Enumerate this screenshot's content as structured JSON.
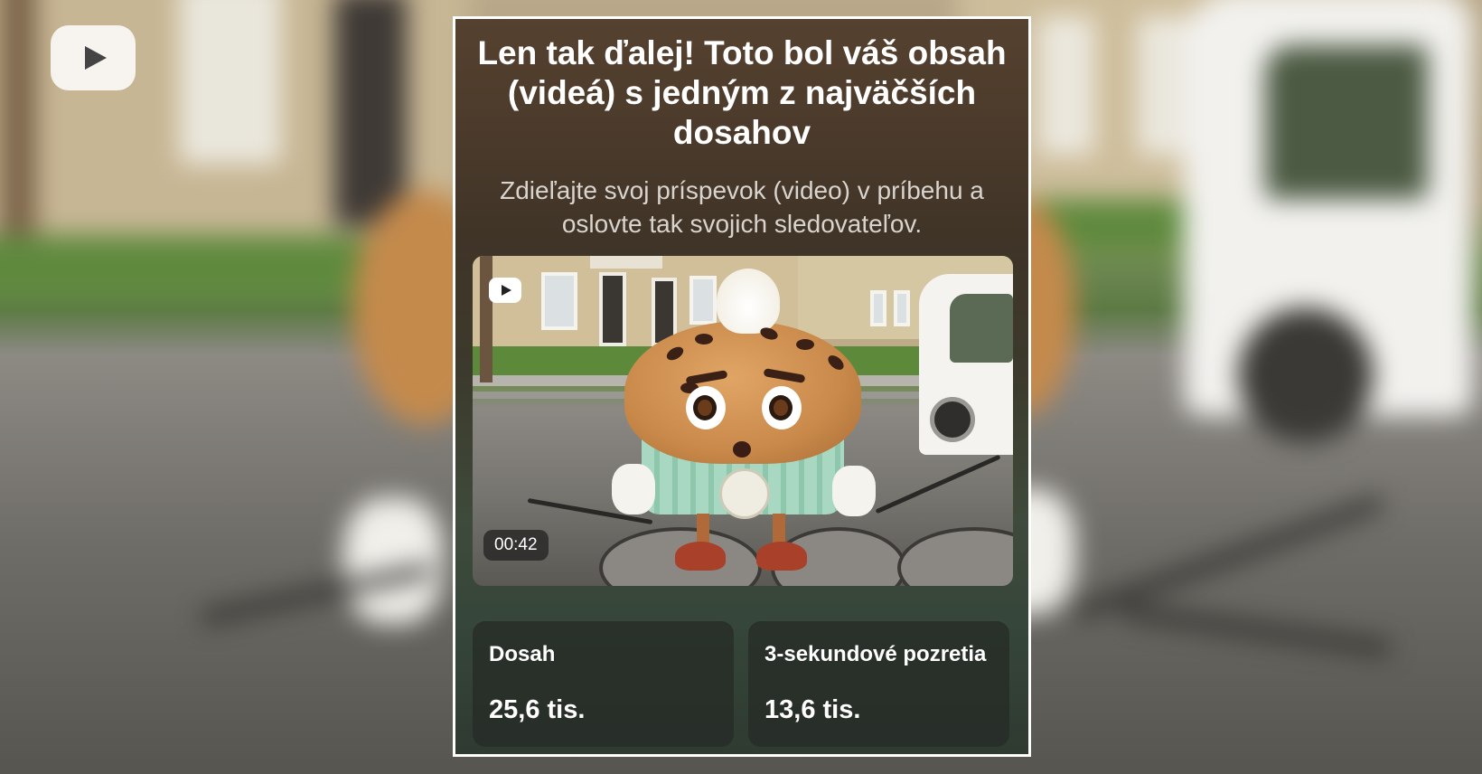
{
  "dialog": {
    "title": "Len tak ďalej! Toto bol váš obsah (videá) s jedným z najväčších dosahov",
    "subtitle": "Zdieľajte svoj príspevok (video) v príbehu a oslovte tak svojich sledovateľov."
  },
  "video": {
    "platform_icon": "youtube-play-icon",
    "duration": "00:42"
  },
  "metrics": [
    {
      "label": "Dosah",
      "value": "25,6 tis."
    },
    {
      "label": "3-sekundové pozretia",
      "value": "13,6 tis."
    }
  ],
  "colors": {
    "card_border": "#ffffff",
    "title_text": "#ffffff",
    "subtitle_text": "#d9d4cd",
    "tile_background": "#262a26"
  }
}
